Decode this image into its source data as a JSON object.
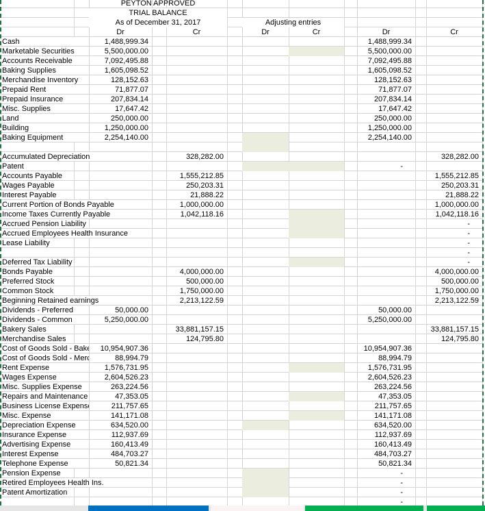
{
  "header": {
    "company": "PEYTON APPROVED",
    "title": "TRIAL BALANCE",
    "date": "As of December 31, 2017",
    "adjusting_title": "Adjusting entries",
    "dr": "Dr",
    "cr": "Cr"
  },
  "colors": {
    "highlight": "#ebeddf",
    "gridline": "#d4d4d4",
    "selection_border": "#217346",
    "tab_blue": "#0070c0",
    "tab_green": "#00b050"
  },
  "rows": [
    {
      "row": 4,
      "label": "Cash",
      "tb_dr": "1,488,999.34",
      "atb_dr": "1,488,999.34"
    },
    {
      "row": 5,
      "label": "Marketable Securities",
      "tb_dr": "5,500,000.00",
      "atb_dr": "5,500,000.00",
      "shaded": [
        "adj_cr"
      ]
    },
    {
      "row": 6,
      "label": "Accounts Receivable",
      "tb_dr": "7,092,495.88",
      "atb_dr": "7,092,495.88"
    },
    {
      "row": 7,
      "label": "Baking Supplies",
      "tb_dr": "1,605,098.52",
      "atb_dr": "1,605,098.52"
    },
    {
      "row": 8,
      "label": "Merchandise Inventory",
      "tb_dr": "128,152.63",
      "atb_dr": "128,152.63"
    },
    {
      "row": 9,
      "label": "Prepaid Rent",
      "tb_dr": "71,877.07",
      "atb_dr": "71,877.07"
    },
    {
      "row": 10,
      "label": "Prepaid Insurance",
      "tb_dr": "207,834.14",
      "atb_dr": "207,834.14"
    },
    {
      "row": 11,
      "label": "Misc. Supplies",
      "tb_dr": "17,647.42",
      "atb_dr": "17,647.42"
    },
    {
      "row": 12,
      "label": "Land",
      "tb_dr": "250,000.00",
      "atb_dr": "250,000.00"
    },
    {
      "row": 13,
      "label": "Building",
      "tb_dr": "1,250,000.00",
      "atb_dr": "1,250,000.00"
    },
    {
      "row": 14,
      "label": "Baking Equipment",
      "tb_dr": "2,254,140.00",
      "atb_dr": "2,254,140.00",
      "shaded": [
        "adj_dr"
      ]
    },
    {
      "row": 15,
      "label": "",
      "shaded": [
        "adj_dr"
      ]
    },
    {
      "row": 16,
      "label": "Accumulated Depreciation",
      "tb_cr": "328,282.00",
      "atb_cr": "328,282.00"
    },
    {
      "row": 17,
      "label": "Patent",
      "atb_dr": "-",
      "shaded": [
        "adj_dr",
        "adj_cr"
      ]
    },
    {
      "row": 18,
      "label": "Accounts Payable",
      "tb_cr": "1,555,212.85",
      "atb_cr": "1,555,212.85"
    },
    {
      "row": 19,
      "label": "Wages Payable",
      "tb_cr": "250,203.31",
      "atb_cr": "250,203.31"
    },
    {
      "row": 20,
      "label": "Interest Payable",
      "tb_cr": "21,888.22",
      "atb_cr": "21,888.22"
    },
    {
      "row": 21,
      "label": "Current Portion of Bonds Payable",
      "tb_cr": "1,000,000.00",
      "atb_cr": "1,000,000.00"
    },
    {
      "row": 22,
      "label": "Income Taxes Currently Payable",
      "tb_cr": "1,042,118.16",
      "atb_cr": "1,042,118.16",
      "shaded": [
        "adj_cr"
      ]
    },
    {
      "row": 23,
      "label": "Accrued Pension Liability",
      "atb_cr": "-",
      "shaded": [
        "adj_cr"
      ]
    },
    {
      "row": 24,
      "label": "Accrued Employees Health Insurance",
      "atb_cr": "-",
      "shaded": [
        "adj_cr"
      ]
    },
    {
      "row": 25,
      "label": "Lease Liability",
      "atb_cr": "-"
    },
    {
      "row": 26,
      "label": "",
      "atb_cr": "-"
    },
    {
      "row": 27,
      "label": "Deferred Tax Liability",
      "atb_cr": "-",
      "shaded": [
        "adj_cr"
      ]
    },
    {
      "row": 28,
      "label": "Bonds Payable",
      "tb_cr": "4,000,000.00",
      "atb_cr": "4,000,000.00"
    },
    {
      "row": 29,
      "label": "Preferred Stock",
      "tb_cr": "500,000.00",
      "atb_cr": "500,000.00"
    },
    {
      "row": 30,
      "label": "Common Stock",
      "tb_cr": "1,750,000.00",
      "atb_cr": "1,750,000.00"
    },
    {
      "row": 31,
      "label": "Beginning Retained earnings",
      "tb_cr": "2,213,122.59",
      "atb_cr": "2,213,122.59"
    },
    {
      "row": 32,
      "label": "Dividends - Preferred",
      "tb_dr": "50,000.00",
      "atb_dr": "50,000.00"
    },
    {
      "row": 33,
      "label": "Dividends - Common",
      "tb_dr": "5,250,000.00",
      "atb_dr": "5,250,000.00"
    },
    {
      "row": 34,
      "label": "Bakery Sales",
      "tb_cr": "33,881,157.15",
      "atb_cr": "33,881,157.15"
    },
    {
      "row": 35,
      "label": "Merchandise Sales",
      "tb_cr": "124,795.80",
      "atb_cr": "124,795.80"
    },
    {
      "row": 36,
      "label": "Cost of Goods Sold - Bake",
      "tb_dr": "10,954,907.36",
      "atb_dr": "10,954,907.36"
    },
    {
      "row": 37,
      "label": "Cost of Goods Sold - Merc",
      "tb_dr": "88,994.79",
      "atb_dr": "88,994.79"
    },
    {
      "row": 38,
      "label": "Rent Expense",
      "tb_dr": "1,576,731.95",
      "atb_dr": "1,576,731.95",
      "shaded": [
        "adj_cr"
      ]
    },
    {
      "row": 39,
      "label": "Wages Expense",
      "tb_dr": "2,604,526.23",
      "atb_dr": "2,604,526.23"
    },
    {
      "row": 40,
      "label": "Misc. Supplies Expense",
      "tb_dr": "263,224.56",
      "atb_dr": "263,224.56"
    },
    {
      "row": 41,
      "label": "Repairs and Maintenance",
      "tb_dr": "47,353.05",
      "atb_dr": "47,353.05",
      "shaded": [
        "adj_cr"
      ]
    },
    {
      "row": 42,
      "label": "Business License Expense",
      "tb_dr": "211,757.65",
      "atb_dr": "211,757.65"
    },
    {
      "row": 43,
      "label": "Misc. Expense",
      "tb_dr": "141,171.08",
      "atb_dr": "141,171.08",
      "shaded": [
        "adj_cr"
      ]
    },
    {
      "row": 44,
      "label": "Depreciation Expense",
      "tb_dr": "634,520.00",
      "atb_dr": "634,520.00",
      "shaded": [
        "adj_dr"
      ]
    },
    {
      "row": 45,
      "label": "Insurance Expense",
      "tb_dr": "112,937.69",
      "atb_dr": "112,937.69"
    },
    {
      "row": 46,
      "label": "Advertising Expense",
      "tb_dr": "160,413.49",
      "atb_dr": "160,413.49"
    },
    {
      "row": 47,
      "label": "Interest Expense",
      "tb_dr": "484,703.27",
      "atb_dr": "484,703.27"
    },
    {
      "row": 48,
      "label": "Telephone Expense",
      "tb_dr": "50,821.34",
      "atb_dr": "50,821.34"
    },
    {
      "row": 49,
      "label": "Pension Expense",
      "atb_dr": "-",
      "shaded": [
        "adj_dr"
      ]
    },
    {
      "row": 50,
      "label": "Retired Employees Health Ins.",
      "atb_dr": "-",
      "shaded": [
        "adj_dr"
      ]
    },
    {
      "row": 51,
      "label": "Patent Amortization",
      "atb_dr": "-",
      "shaded": [
        "adj_dr"
      ]
    },
    {
      "row": 52,
      "label": "",
      "atb_dr": "-"
    }
  ]
}
